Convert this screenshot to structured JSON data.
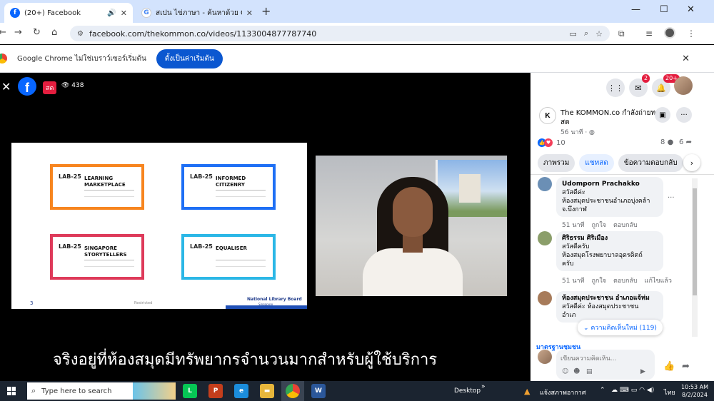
{
  "browser": {
    "tabs": [
      {
        "title": "(20+) Facebook",
        "active": true
      },
      {
        "title": "สเปน ไข่ภาษา - ค้นหาด้วย Google",
        "active": false
      }
    ],
    "url": "facebook.com/thekommon.co/videos/1133004877787740",
    "infobar_message": "Google Chrome ไม่ใช่เบราว์เซอร์เริ่มต้น",
    "infobar_button": "ตั้งเป็นค่าเริ่มต้น"
  },
  "video": {
    "live_label": "สด",
    "viewer_count": "438",
    "subtitle": "จริงอยู่ที่ห้องสมุดมีทรัพยากรจำนวนมากสำหรับผู้ใช้บริการ",
    "slide": {
      "cards": [
        {
          "lab": "LAB-25",
          "title_1": "LEARNING",
          "title_2": "MARKETPLACE",
          "color": "#f7851f"
        },
        {
          "lab": "LAB-25",
          "title_1": "INFORMED",
          "title_2": "CITIZENRY",
          "color": "#1e6ff5"
        },
        {
          "lab": "LAB-25",
          "title_1": "SINGAPORE",
          "title_2": "STORYTELLERS",
          "color": "#de3a5a"
        },
        {
          "lab": "LAB-25",
          "title_1": "EQUALISER",
          "title_2": "",
          "color": "#2bb7e6"
        }
      ],
      "page_number": "3",
      "footer_mid": "Restricted",
      "nlb_name": "National Library Board",
      "nlb_sub": "Singapore"
    }
  },
  "panel": {
    "notif_badges": {
      "messenger": "2",
      "notifications": "20+"
    },
    "page_initial": "K",
    "page_name": "The KOMMON.co กำลังถ่ายทอดสด",
    "post_time": "56 นาที · ",
    "reaction_count": "10",
    "comment_count": "8",
    "share_count": "6",
    "chips": [
      "ภาพรวม",
      "แชทสด",
      "ข้อความตอบกลับ"
    ],
    "comments": [
      {
        "name": "Udomporn Prachakko",
        "text_1": "สวัสดีค่ะ",
        "text_2": "ห้องสมุดประชาชนอำเภอบุ่งคล้า",
        "text_3": "จ.บึงกาฬ",
        "time": "51 นาที",
        "like": "ถูกใจ",
        "reply": "ตอบกลับ"
      },
      {
        "name": "ศิริธรรม ศิริเมือง",
        "text_1": "สวัสดีครับ",
        "text_2": "ห้องสมุดโรงพยาบาลอุดรดิตถ์",
        "text_3": "ครับ",
        "time": "51 นาที",
        "like": "ถูกใจ",
        "reply": "ตอบกลับ",
        "edited": "แก้ไขแล้ว"
      },
      {
        "name": "ห้องสมุดประชาชน อำเภอแจ้ห่ม",
        "text_1": "สวัสดีค่ะ ห้องสมุดประชาชน",
        "text_2": "อำเภ",
        "text_3": ""
      }
    ],
    "new_comments": "ความคิดเห็นใหม่ (119)",
    "section_label": "มาตรฐานชุมชน",
    "comment_placeholder": "เขียนความคิดเห็น..."
  },
  "taskbar": {
    "search_placeholder": "Type here to search",
    "desktop_label": "Desktop",
    "weather": "แจ้งสภาพอากาศ",
    "lang": "ไทย",
    "time": "10:53 AM",
    "date": "8/2/2024"
  }
}
